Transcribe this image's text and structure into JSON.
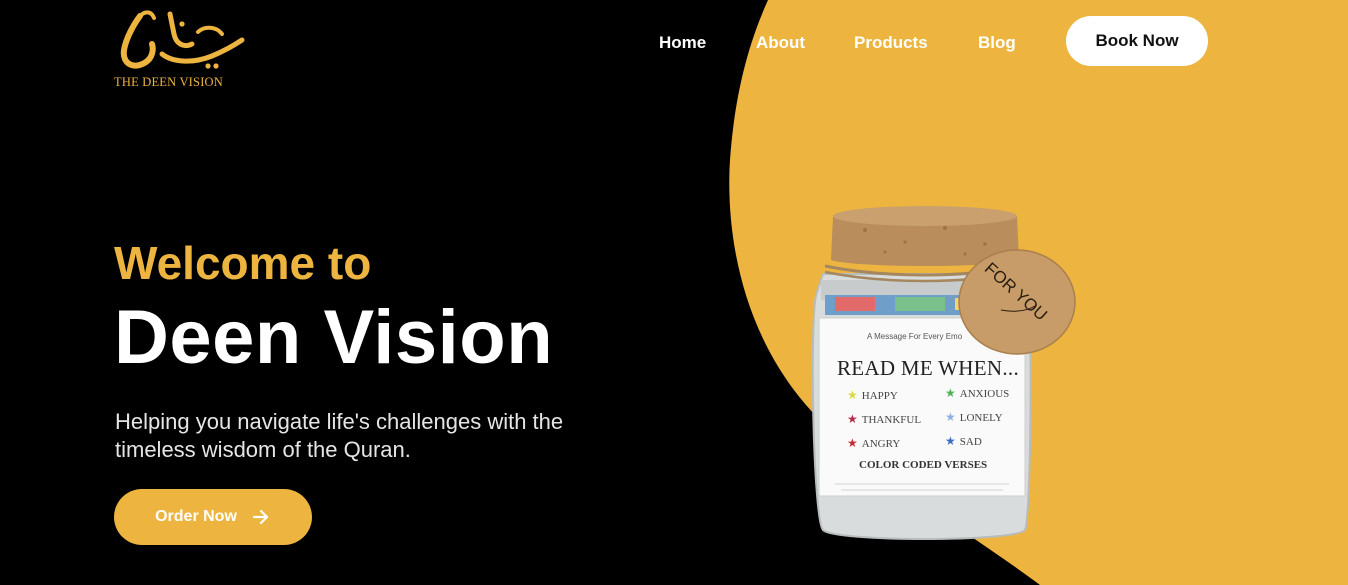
{
  "colors": {
    "background": "#000000",
    "accent": "#edb53f",
    "button_light": "#ffffff"
  },
  "brand": {
    "logo_text": "THE DEEN VISION"
  },
  "nav": {
    "items": [
      {
        "label": "Home"
      },
      {
        "label": "About"
      },
      {
        "label": "Products"
      },
      {
        "label": "Blog"
      }
    ],
    "cta": "Book Now"
  },
  "hero": {
    "welcome": "Welcome to",
    "title": "Deen Vision",
    "subtitle": "Helping you navigate life's challenges with the timeless wisdom of the Quran.",
    "cta": "Order Now",
    "cta_icon": "arrow-right-icon"
  },
  "product": {
    "tag": "FOR YOU",
    "label_top": "A Message For Every Emo",
    "label_main": "READ ME WHEN...",
    "moods": [
      "HAPPY",
      "ANXIOUS",
      "THANKFUL",
      "LONELY",
      "ANGRY",
      "SAD"
    ],
    "label_footer": "COLOR CODED VERSES"
  }
}
